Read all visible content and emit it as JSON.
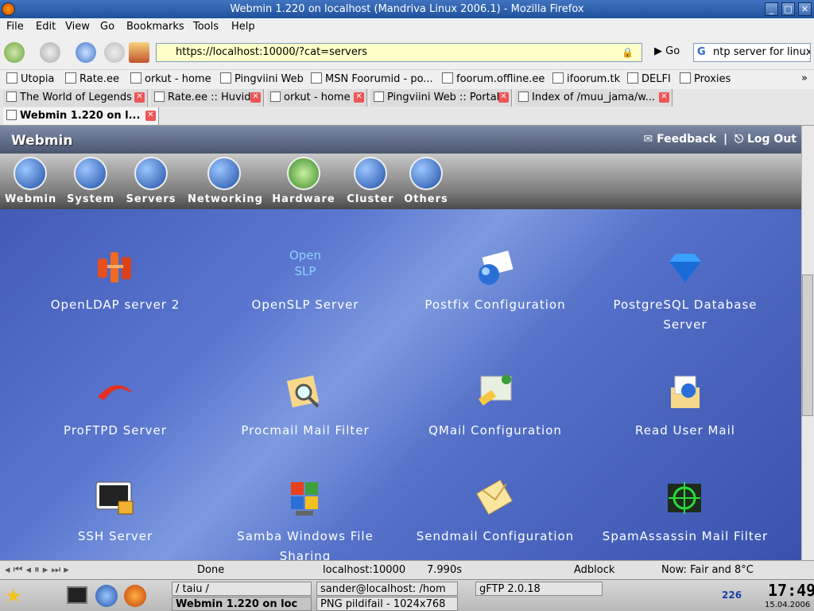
{
  "window": {
    "title": "Webmin 1.220 on localhost (Mandriva Linux 2006.1) - Mozilla Firefox"
  },
  "menu": [
    "File",
    "Edit",
    "View",
    "Go",
    "Bookmarks",
    "Tools",
    "Help"
  ],
  "nav": {
    "url": "https://localhost:10000/?cat=servers",
    "go_label": "Go",
    "search_value": "ntp server for linux"
  },
  "bookmarks": [
    "Utopia",
    "Rate.ee",
    "orkut - home",
    "Pingviini Web",
    "MSN Foorumid - po...",
    "foorum.offline.ee",
    "ifoorum.tk",
    "DELFI",
    "Proxies"
  ],
  "tabs": [
    "The World of Legends",
    "Rate.ee :: Huvid",
    "orkut - home",
    "Pingviini Web :: Portal",
    "Index of /muu_jama/w...",
    "Webmin 1.220 on l..."
  ],
  "webmin": {
    "logo": "Webmin",
    "feedback": "Feedback",
    "logout": "Log Out",
    "categories": [
      "Webmin",
      "System",
      "Servers",
      "Networking",
      "Hardware",
      "Cluster",
      "Others"
    ],
    "modules": [
      {
        "label": "OpenLDAP server 2",
        "icon": "openldap-icon"
      },
      {
        "label": "OpenSLP Server",
        "icon": "openslp-icon",
        "icon_text": "Open SLP"
      },
      {
        "label": "Postfix Configuration",
        "icon": "postfix-icon"
      },
      {
        "label": "PostgreSQL Database Server",
        "icon": "postgresql-icon"
      },
      {
        "label": "ProFTPD Server",
        "icon": "proftpd-icon"
      },
      {
        "label": "Procmail Mail Filter",
        "icon": "procmail-icon"
      },
      {
        "label": "QMail Configuration",
        "icon": "qmail-icon"
      },
      {
        "label": "Read User Mail",
        "icon": "read-mail-icon"
      },
      {
        "label": "SSH Server",
        "icon": "ssh-icon"
      },
      {
        "label": "Samba Windows File Sharing",
        "icon": "samba-icon"
      },
      {
        "label": "Sendmail Configuration",
        "icon": "sendmail-icon"
      },
      {
        "label": "SpamAssassin Mail Filter",
        "icon": "spamassassin-icon"
      }
    ]
  },
  "status": {
    "text": "Done",
    "host": "localhost:10000",
    "time": "7.990s",
    "adblock": "Adblock",
    "weather": "Now: Fair and 8°C"
  },
  "taskbar": {
    "tasks": [
      "/ taiu /",
      "Webmin 1.220 on loc",
      "sander@localhost: /hom",
      "PNG pildifail - 1024x768",
      "gFTP 2.0.18"
    ],
    "counter": "226",
    "clock": "17:49",
    "date": "15.04.2006"
  }
}
